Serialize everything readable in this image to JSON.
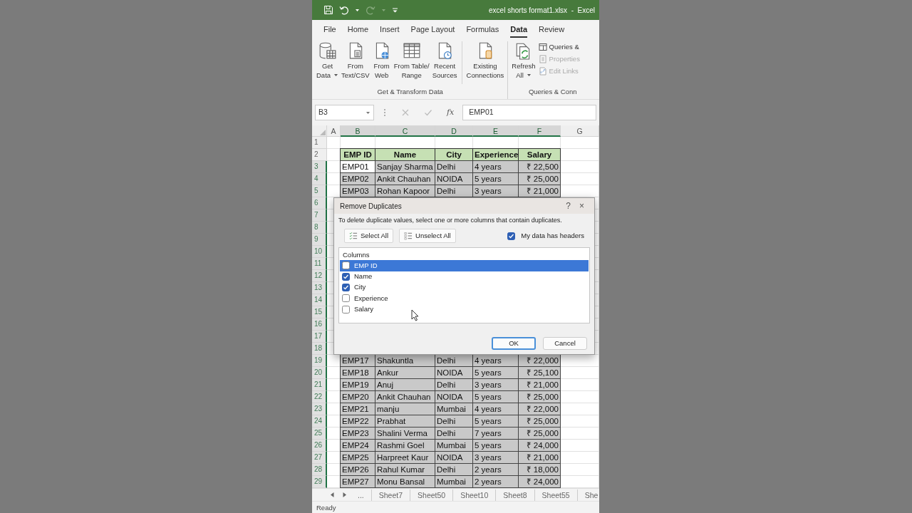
{
  "title_bar": {
    "title": "excel shorts format1.xlsx  -  Excel",
    "redo_disabled": true
  },
  "menu_tabs": [
    {
      "label": "File",
      "selected": false
    },
    {
      "label": "Home",
      "selected": false
    },
    {
      "label": "Insert",
      "selected": false
    },
    {
      "label": "Page Layout",
      "selected": false
    },
    {
      "label": "Formulas",
      "selected": false
    },
    {
      "label": "Data",
      "selected": true
    },
    {
      "label": "Review",
      "selected": false
    }
  ],
  "ribbon": {
    "groups": [
      {
        "label": "Get & Transform Data",
        "items": [
          {
            "kind": "large",
            "lines": [
              "Get",
              "Data"
            ],
            "dropdown": true
          },
          {
            "kind": "large",
            "lines": [
              "From",
              "Text/CSV"
            ],
            "dropdown": false
          },
          {
            "kind": "large",
            "lines": [
              "From",
              "Web"
            ],
            "dropdown": false
          },
          {
            "kind": "large",
            "lines": [
              "From Table/",
              "Range"
            ],
            "dropdown": false
          },
          {
            "kind": "large",
            "lines": [
              "Recent",
              "Sources"
            ],
            "dropdown": false
          },
          {
            "kind": "separator"
          },
          {
            "kind": "large",
            "lines": [
              "Existing",
              "Connections"
            ],
            "dropdown": false
          }
        ]
      },
      {
        "label": "Queries & Conn",
        "items": [
          {
            "kind": "large",
            "lines": [
              "Refresh",
              "All"
            ],
            "dropdown": true
          },
          {
            "kind": "small",
            "label": "Queries &",
            "disabled": false
          },
          {
            "kind": "small",
            "label": "Properties",
            "disabled": true
          },
          {
            "kind": "small",
            "label": "Edit Links",
            "disabled": true
          }
        ]
      }
    ]
  },
  "formula_bar": {
    "name_box": "B3",
    "function_label": "fx",
    "formula": "EMP01"
  },
  "grid": {
    "columns": [
      {
        "label": "A",
        "selected": false
      },
      {
        "label": "B",
        "selected": true,
        "active": true,
        "numeric": false
      },
      {
        "label": "C",
        "selected": true,
        "active": false,
        "numeric": false
      },
      {
        "label": "D",
        "selected": true,
        "active": false,
        "numeric": false
      },
      {
        "label": "E",
        "selected": true,
        "active": false,
        "numeric": false
      },
      {
        "label": "F",
        "selected": true,
        "active": false,
        "numeric": true
      },
      {
        "label": "G",
        "selected": false
      }
    ],
    "rows": [
      {
        "number": "1",
        "kind": "blank",
        "selected": false
      },
      {
        "number": "2",
        "kind": "header",
        "selected": false,
        "cells": [
          "EMP ID",
          "Name",
          "City",
          "Experience",
          "Salary"
        ]
      },
      {
        "number": "3",
        "kind": "data",
        "selected": true,
        "active": true,
        "cells": [
          "EMP01",
          "Sanjay Sharma",
          "Delhi",
          "4 years",
          "₹ 22,500"
        ]
      },
      {
        "number": "4",
        "kind": "data",
        "selected": true,
        "active": false,
        "cells": [
          "EMP02",
          "Ankit Chauhan",
          "NOIDA",
          "5 years",
          "₹ 25,000"
        ]
      },
      {
        "number": "5",
        "kind": "data",
        "selected": true,
        "active": false,
        "cells": [
          "EMP03",
          "Rohan Kapoor",
          "Delhi",
          "3 years",
          "₹ 21,000"
        ]
      },
      {
        "number": "6",
        "kind": "data",
        "selected": true
      },
      {
        "number": "7",
        "kind": "data",
        "selected": true
      },
      {
        "number": "8",
        "kind": "data",
        "selected": true
      },
      {
        "number": "9",
        "kind": "data",
        "selected": true
      },
      {
        "number": "10",
        "kind": "data",
        "selected": true
      },
      {
        "number": "11",
        "kind": "data",
        "selected": true
      },
      {
        "number": "12",
        "kind": "data",
        "selected": true
      },
      {
        "number": "13",
        "kind": "data",
        "selected": true
      },
      {
        "number": "14",
        "kind": "data",
        "selected": true
      },
      {
        "number": "15",
        "kind": "data",
        "selected": true
      },
      {
        "number": "16",
        "kind": "data",
        "selected": true
      },
      {
        "number": "17",
        "kind": "data",
        "selected": true
      },
      {
        "number": "18",
        "kind": "data",
        "selected": true
      },
      {
        "number": "19",
        "kind": "data",
        "selected": true,
        "active": false,
        "cells": [
          "EMP17",
          "Shakuntla",
          "Delhi",
          "4 years",
          "₹ 22,000"
        ]
      },
      {
        "number": "20",
        "kind": "data",
        "selected": true,
        "active": false,
        "cells": [
          "EMP18",
          "Ankur",
          "NOIDA",
          "5 years",
          "₹ 25,100"
        ]
      },
      {
        "number": "21",
        "kind": "data",
        "selected": true,
        "active": false,
        "cells": [
          "EMP19",
          "Anuj",
          "Delhi",
          "3 years",
          "₹ 21,000"
        ]
      },
      {
        "number": "22",
        "kind": "data",
        "selected": true,
        "active": false,
        "cells": [
          "EMP20",
          "Ankit Chauhan",
          "NOIDA",
          "5 years",
          "₹ 25,000"
        ]
      },
      {
        "number": "23",
        "kind": "data",
        "selected": true,
        "active": false,
        "cells": [
          "EMP21",
          "manju",
          "Mumbai",
          "4 years",
          "₹ 22,000"
        ]
      },
      {
        "number": "24",
        "kind": "data",
        "selected": true,
        "active": false,
        "cells": [
          "EMP22",
          "Prabhat",
          "Delhi",
          "5 years",
          "₹ 25,000"
        ]
      },
      {
        "number": "25",
        "kind": "data",
        "selected": true,
        "active": false,
        "cells": [
          "EMP23",
          "Shalini Verma",
          "Delhi",
          "7 years",
          "₹ 25,000"
        ]
      },
      {
        "number": "26",
        "kind": "data",
        "selected": true,
        "active": false,
        "cells": [
          "EMP24",
          "Rashmi Goel",
          "Mumbai",
          "5 years",
          "₹ 24,000"
        ]
      },
      {
        "number": "27",
        "kind": "data",
        "selected": true,
        "active": false,
        "cells": [
          "EMP25",
          "Harpreet Kaur",
          "NOIDA",
          "3 years",
          "₹ 21,000"
        ]
      },
      {
        "number": "28",
        "kind": "data",
        "selected": true,
        "active": false,
        "cells": [
          "EMP26",
          "Rahul Kumar",
          "Delhi",
          "2 years",
          "₹ 18,000"
        ]
      },
      {
        "number": "29",
        "kind": "data",
        "selected": true,
        "active": false,
        "cells": [
          "EMP27",
          "Monu Bansal",
          "Mumbai",
          "2 years",
          "₹ 24,000"
        ]
      }
    ]
  },
  "dialog": {
    "title": "Remove Duplicates",
    "help": "?",
    "close": "×",
    "description": "To delete duplicate values, select one or more columns that contain duplicates.",
    "buttons": [
      {
        "label": "Select All"
      },
      {
        "label": "Unselect All"
      }
    ],
    "headers_checkbox": {
      "label": "My data has headers",
      "checked": true
    },
    "list_header": "Columns",
    "columns": [
      {
        "label": "EMP ID",
        "checked": false,
        "selected": true
      },
      {
        "label": "Name",
        "checked": true,
        "selected": false
      },
      {
        "label": "City",
        "checked": true,
        "selected": false
      },
      {
        "label": "Experience",
        "checked": false,
        "selected": false
      },
      {
        "label": "Salary",
        "checked": false,
        "selected": false
      }
    ],
    "footer_buttons": [
      {
        "label": "OK",
        "default": true
      },
      {
        "label": "Cancel",
        "default": false
      }
    ]
  },
  "sheet_tabs": {
    "more": "...",
    "tabs": [
      {
        "label": "Sheet7",
        "selected": false
      },
      {
        "label": "Sheet50",
        "selected": false
      },
      {
        "label": "Sheet10",
        "selected": false
      },
      {
        "label": "Sheet8",
        "selected": false
      },
      {
        "label": "Sheet55",
        "selected": false
      },
      {
        "label": "She",
        "selected": false
      }
    ]
  },
  "status_bar": {
    "text": "Ready"
  }
}
